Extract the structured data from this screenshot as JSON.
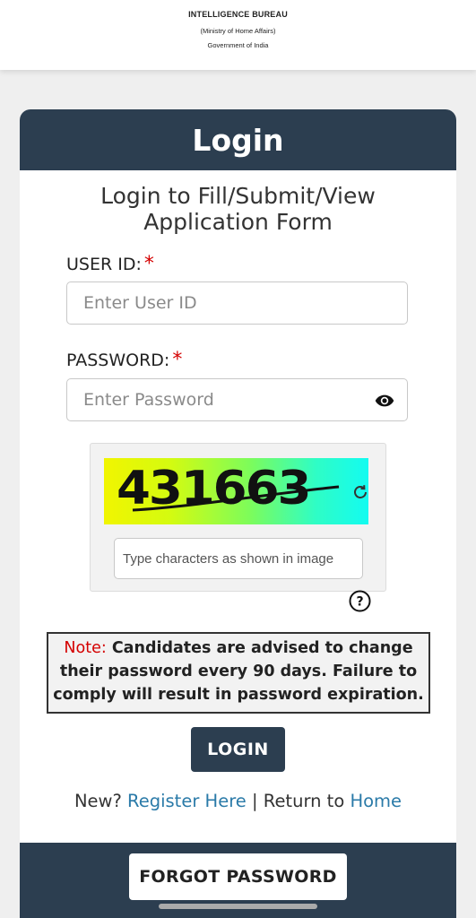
{
  "header": {
    "org_name": "INTELLIGENCE BUREAU",
    "ministry": "(Ministry of Home Affairs)",
    "government": "Government of India"
  },
  "card": {
    "title": "Login",
    "subtitle_line1": "Login to Fill/Submit/View",
    "subtitle_line2": "Application Form"
  },
  "form": {
    "user_id_label": "USER ID:",
    "user_id_placeholder": "Enter User ID",
    "password_label": "PASSWORD:",
    "password_placeholder": "Enter Password",
    "required_mark": "*"
  },
  "captcha": {
    "code": "431663",
    "input_placeholder": "Type characters as shown in image",
    "icons": {
      "refresh": "refresh-icon",
      "help": "help-icon",
      "eye": "eye-icon"
    }
  },
  "note": {
    "label": "Note:",
    "text": "Candidates are advised to change their password every 90 days. Failure to comply will result in password expiration."
  },
  "actions": {
    "login_label": "LOGIN",
    "new_text": "New?",
    "register_link": "Register Here",
    "separator": "|",
    "return_text": "Return to",
    "home_link": "Home",
    "forgot_label": "FORGOT PASSWORD"
  },
  "colors": {
    "primary": "#2c3e50",
    "required": "#d40000",
    "link": "#2a7aa8",
    "background": "#efefef"
  }
}
